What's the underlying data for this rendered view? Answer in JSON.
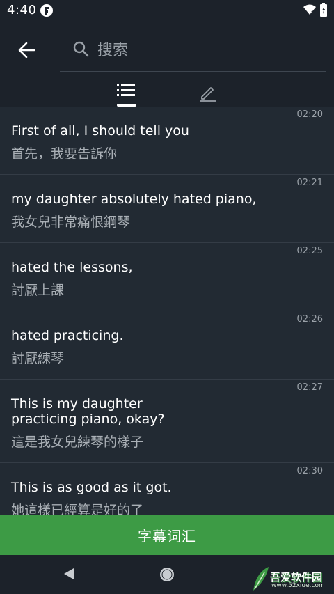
{
  "status_bar": {
    "time": "4:40",
    "app_icon": "app-notification-icon",
    "wifi_icon": "wifi-icon",
    "battery_icon": "battery-charging-icon"
  },
  "header": {
    "back_icon": "arrow-left-icon",
    "search": {
      "placeholder": "搜索",
      "value": "",
      "icon": "search-icon"
    },
    "tabs": [
      {
        "icon": "list-icon",
        "selected": true
      },
      {
        "icon": "edit-pencil-icon",
        "selected": false
      }
    ]
  },
  "subtitles": [
    {
      "time": "02:20",
      "en": "First of all, I should tell you",
      "zh": "首先，我要告訴你"
    },
    {
      "time": "02:21",
      "en": "my daughter absolutely hated piano,",
      "zh": "我女兒非常痛恨鋼琴"
    },
    {
      "time": "02:25",
      "en": "hated the lessons,",
      "zh": "討厭上課"
    },
    {
      "time": "02:26",
      "en": "hated practicing.",
      "zh": "討厭練琴"
    },
    {
      "time": "02:27",
      "en": "This is my daughter practicing piano, okay?",
      "zh": "這是我女兒練琴的樣子"
    },
    {
      "time": "02:30",
      "en": "This is as good as it got.",
      "zh": "她這樣已經算是好的了"
    }
  ],
  "vocab_button": {
    "label": "字幕词汇"
  },
  "nav_bar": {
    "back_icon": "nav-back-triangle-icon",
    "home_icon": "nav-home-circle-icon"
  },
  "watermark": {
    "text": "吾爱软件园",
    "sub": "www.52xiue.com"
  },
  "colors": {
    "background": "#222a33",
    "header": "#1c222a",
    "divider": "#343c46",
    "accent_green": "#3d9b45",
    "secondary_text": "#aab0b6"
  }
}
